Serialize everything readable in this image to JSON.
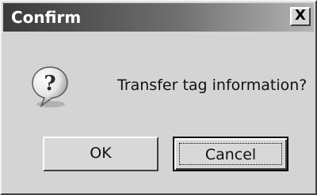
{
  "window": {
    "title": "Confirm",
    "close_label": "X"
  },
  "content": {
    "icon": "question-icon",
    "message": "Transfer tag information?"
  },
  "buttons": {
    "ok_label": "OK",
    "cancel_label": "Cancel"
  }
}
